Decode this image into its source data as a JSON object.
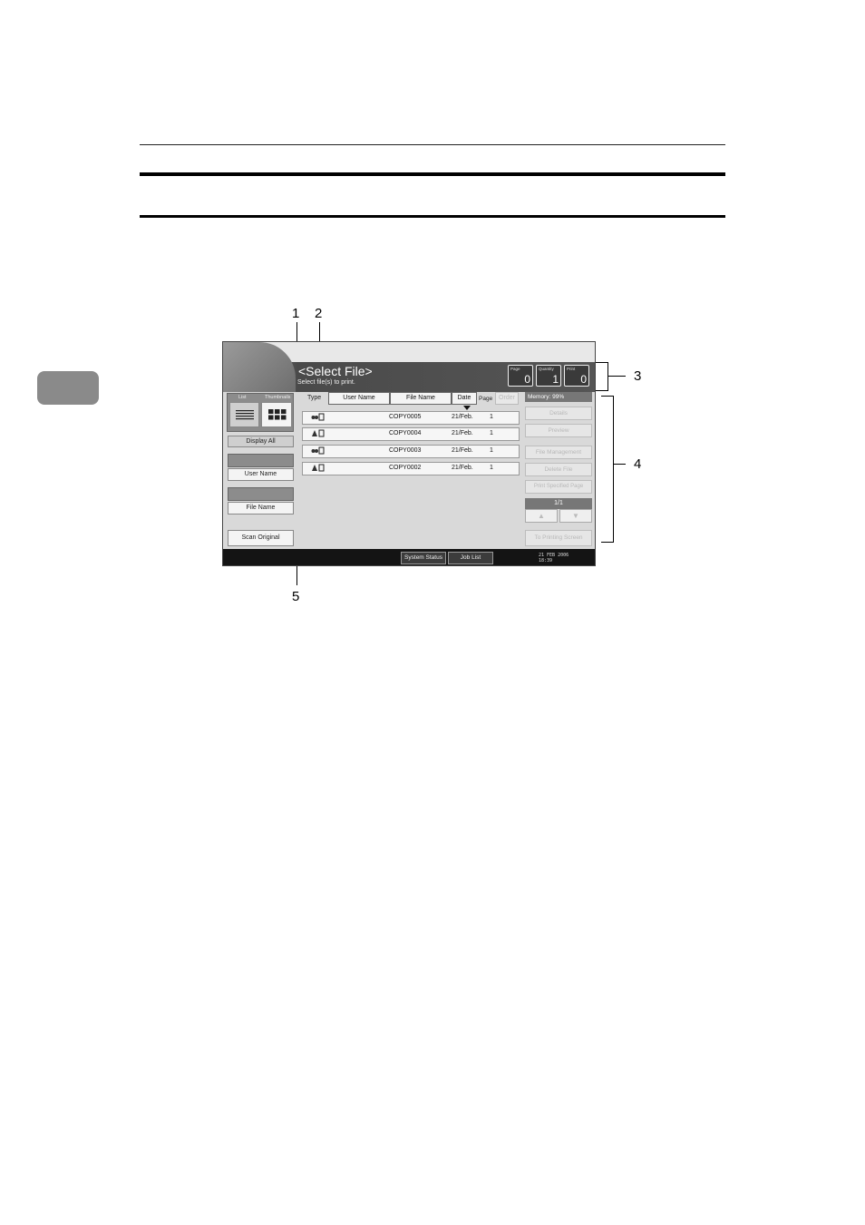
{
  "screen": {
    "title": "<Select File>",
    "subtitle": "Select file(s) to print.",
    "counters": [
      {
        "label": "Page",
        "value": "0"
      },
      {
        "label": "Quantity",
        "value": "1"
      },
      {
        "label": "Print",
        "value": "0"
      }
    ],
    "view": {
      "list_label": "List",
      "thumbnails_label": "Thumbnails"
    },
    "left_buttons": {
      "display_all": "Display All",
      "user_name": "User Name",
      "file_name": "File Name",
      "scan_original": "Scan Original"
    },
    "columns": {
      "type": "Type",
      "user_name": "User Name",
      "file_name": "File Name",
      "date": "Date",
      "page": "Page",
      "order": "Order"
    },
    "files": [
      {
        "type_icon": "users-doc-icon",
        "file_name": "COPY0005",
        "date": "21/Feb.",
        "page": "1"
      },
      {
        "type_icon": "network-doc-icon",
        "file_name": "COPY0004",
        "date": "21/Feb.",
        "page": "1"
      },
      {
        "type_icon": "users-doc-icon",
        "file_name": "COPY0003",
        "date": "21/Feb.",
        "page": "1"
      },
      {
        "type_icon": "network-doc-icon",
        "file_name": "COPY0002",
        "date": "21/Feb.",
        "page": "1"
      }
    ],
    "memory": "Memory:  99%",
    "right_buttons": {
      "details": "Details",
      "preview": "Preview",
      "file_management": "File Management",
      "delete_file": "Delete File",
      "print_specified_page": "Print Specified Page",
      "to_printing_screen": "To Printing Screen"
    },
    "pager": "1/1",
    "bottom": {
      "system_status": "System Status",
      "job_list": "Job List",
      "date": "21 FEB  2006",
      "time": "18:39"
    }
  },
  "callouts": {
    "c1": "1",
    "c2": "2",
    "c3": "3",
    "c4": "4",
    "c5": "5"
  }
}
